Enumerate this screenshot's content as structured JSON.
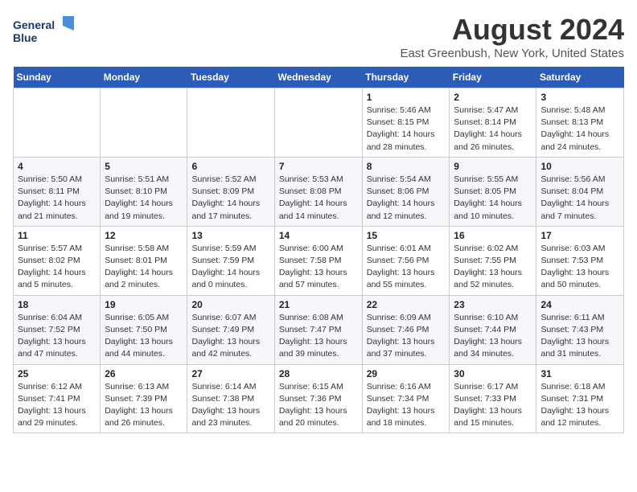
{
  "header": {
    "logo_line1": "General",
    "logo_line2": "Blue",
    "title": "August 2024",
    "subtitle": "East Greenbush, New York, United States"
  },
  "weekdays": [
    "Sunday",
    "Monday",
    "Tuesday",
    "Wednesday",
    "Thursday",
    "Friday",
    "Saturday"
  ],
  "weeks": [
    [
      {
        "day": "",
        "detail": ""
      },
      {
        "day": "",
        "detail": ""
      },
      {
        "day": "",
        "detail": ""
      },
      {
        "day": "",
        "detail": ""
      },
      {
        "day": "1",
        "detail": "Sunrise: 5:46 AM\nSunset: 8:15 PM\nDaylight: 14 hours\nand 28 minutes."
      },
      {
        "day": "2",
        "detail": "Sunrise: 5:47 AM\nSunset: 8:14 PM\nDaylight: 14 hours\nand 26 minutes."
      },
      {
        "day": "3",
        "detail": "Sunrise: 5:48 AM\nSunset: 8:13 PM\nDaylight: 14 hours\nand 24 minutes."
      }
    ],
    [
      {
        "day": "4",
        "detail": "Sunrise: 5:50 AM\nSunset: 8:11 PM\nDaylight: 14 hours\nand 21 minutes."
      },
      {
        "day": "5",
        "detail": "Sunrise: 5:51 AM\nSunset: 8:10 PM\nDaylight: 14 hours\nand 19 minutes."
      },
      {
        "day": "6",
        "detail": "Sunrise: 5:52 AM\nSunset: 8:09 PM\nDaylight: 14 hours\nand 17 minutes."
      },
      {
        "day": "7",
        "detail": "Sunrise: 5:53 AM\nSunset: 8:08 PM\nDaylight: 14 hours\nand 14 minutes."
      },
      {
        "day": "8",
        "detail": "Sunrise: 5:54 AM\nSunset: 8:06 PM\nDaylight: 14 hours\nand 12 minutes."
      },
      {
        "day": "9",
        "detail": "Sunrise: 5:55 AM\nSunset: 8:05 PM\nDaylight: 14 hours\nand 10 minutes."
      },
      {
        "day": "10",
        "detail": "Sunrise: 5:56 AM\nSunset: 8:04 PM\nDaylight: 14 hours\nand 7 minutes."
      }
    ],
    [
      {
        "day": "11",
        "detail": "Sunrise: 5:57 AM\nSunset: 8:02 PM\nDaylight: 14 hours\nand 5 minutes."
      },
      {
        "day": "12",
        "detail": "Sunrise: 5:58 AM\nSunset: 8:01 PM\nDaylight: 14 hours\nand 2 minutes."
      },
      {
        "day": "13",
        "detail": "Sunrise: 5:59 AM\nSunset: 7:59 PM\nDaylight: 14 hours\nand 0 minutes."
      },
      {
        "day": "14",
        "detail": "Sunrise: 6:00 AM\nSunset: 7:58 PM\nDaylight: 13 hours\nand 57 minutes."
      },
      {
        "day": "15",
        "detail": "Sunrise: 6:01 AM\nSunset: 7:56 PM\nDaylight: 13 hours\nand 55 minutes."
      },
      {
        "day": "16",
        "detail": "Sunrise: 6:02 AM\nSunset: 7:55 PM\nDaylight: 13 hours\nand 52 minutes."
      },
      {
        "day": "17",
        "detail": "Sunrise: 6:03 AM\nSunset: 7:53 PM\nDaylight: 13 hours\nand 50 minutes."
      }
    ],
    [
      {
        "day": "18",
        "detail": "Sunrise: 6:04 AM\nSunset: 7:52 PM\nDaylight: 13 hours\nand 47 minutes."
      },
      {
        "day": "19",
        "detail": "Sunrise: 6:05 AM\nSunset: 7:50 PM\nDaylight: 13 hours\nand 44 minutes."
      },
      {
        "day": "20",
        "detail": "Sunrise: 6:07 AM\nSunset: 7:49 PM\nDaylight: 13 hours\nand 42 minutes."
      },
      {
        "day": "21",
        "detail": "Sunrise: 6:08 AM\nSunset: 7:47 PM\nDaylight: 13 hours\nand 39 minutes."
      },
      {
        "day": "22",
        "detail": "Sunrise: 6:09 AM\nSunset: 7:46 PM\nDaylight: 13 hours\nand 37 minutes."
      },
      {
        "day": "23",
        "detail": "Sunrise: 6:10 AM\nSunset: 7:44 PM\nDaylight: 13 hours\nand 34 minutes."
      },
      {
        "day": "24",
        "detail": "Sunrise: 6:11 AM\nSunset: 7:43 PM\nDaylight: 13 hours\nand 31 minutes."
      }
    ],
    [
      {
        "day": "25",
        "detail": "Sunrise: 6:12 AM\nSunset: 7:41 PM\nDaylight: 13 hours\nand 29 minutes."
      },
      {
        "day": "26",
        "detail": "Sunrise: 6:13 AM\nSunset: 7:39 PM\nDaylight: 13 hours\nand 26 minutes."
      },
      {
        "day": "27",
        "detail": "Sunrise: 6:14 AM\nSunset: 7:38 PM\nDaylight: 13 hours\nand 23 minutes."
      },
      {
        "day": "28",
        "detail": "Sunrise: 6:15 AM\nSunset: 7:36 PM\nDaylight: 13 hours\nand 20 minutes."
      },
      {
        "day": "29",
        "detail": "Sunrise: 6:16 AM\nSunset: 7:34 PM\nDaylight: 13 hours\nand 18 minutes."
      },
      {
        "day": "30",
        "detail": "Sunrise: 6:17 AM\nSunset: 7:33 PM\nDaylight: 13 hours\nand 15 minutes."
      },
      {
        "day": "31",
        "detail": "Sunrise: 6:18 AM\nSunset: 7:31 PM\nDaylight: 13 hours\nand 12 minutes."
      }
    ]
  ]
}
